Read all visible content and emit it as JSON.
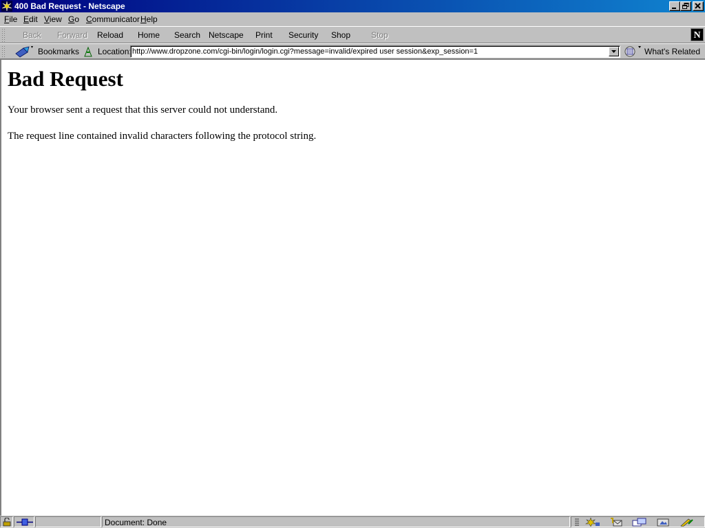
{
  "window": {
    "title": "400 Bad Request - Netscape",
    "colors": {
      "titlebar_start": "#000080",
      "titlebar_end": "#1084d0",
      "chrome": "#c0c0c0"
    }
  },
  "menu": {
    "file": {
      "accel": "F",
      "rest": "ile"
    },
    "edit": {
      "accel": "E",
      "rest": "dit"
    },
    "view": {
      "accel": "V",
      "rest": "iew"
    },
    "go": {
      "accel": "G",
      "rest": "o"
    },
    "communicator": {
      "accel": "C",
      "rest": "ommunicator"
    },
    "help": {
      "accel": "H",
      "rest": "elp"
    }
  },
  "navigation": {
    "back": "Back",
    "forward": "Forward",
    "reload": "Reload",
    "home": "Home",
    "search": "Search",
    "netscape": "Netscape",
    "print": "Print",
    "security": "Security",
    "shop": "Shop",
    "stop": "Stop"
  },
  "location_bar": {
    "bookmarks_label": "Bookmarks",
    "location_label": "Location:",
    "url": "http://www.dropzone.com/cgi-bin/login/login.cgi?message=invalid/expired user session&exp_session=1",
    "whats_related_label": "What's Related"
  },
  "page": {
    "heading": "Bad Request",
    "paragraph1": "Your browser sent a request that this server could not understand.",
    "paragraph2": "The request line contained invalid characters following the protocol string."
  },
  "status": {
    "text": "Document: Done"
  },
  "icons": [
    "netscape-app-icon",
    "minimize-icon",
    "restore-icon",
    "close-icon",
    "netscape-n-logo",
    "bookmarks-icon",
    "location-icon",
    "dropdown-arrow-icon",
    "whats-related-icon",
    "security-lock-icon",
    "connection-icon",
    "component-bar-icons"
  ]
}
